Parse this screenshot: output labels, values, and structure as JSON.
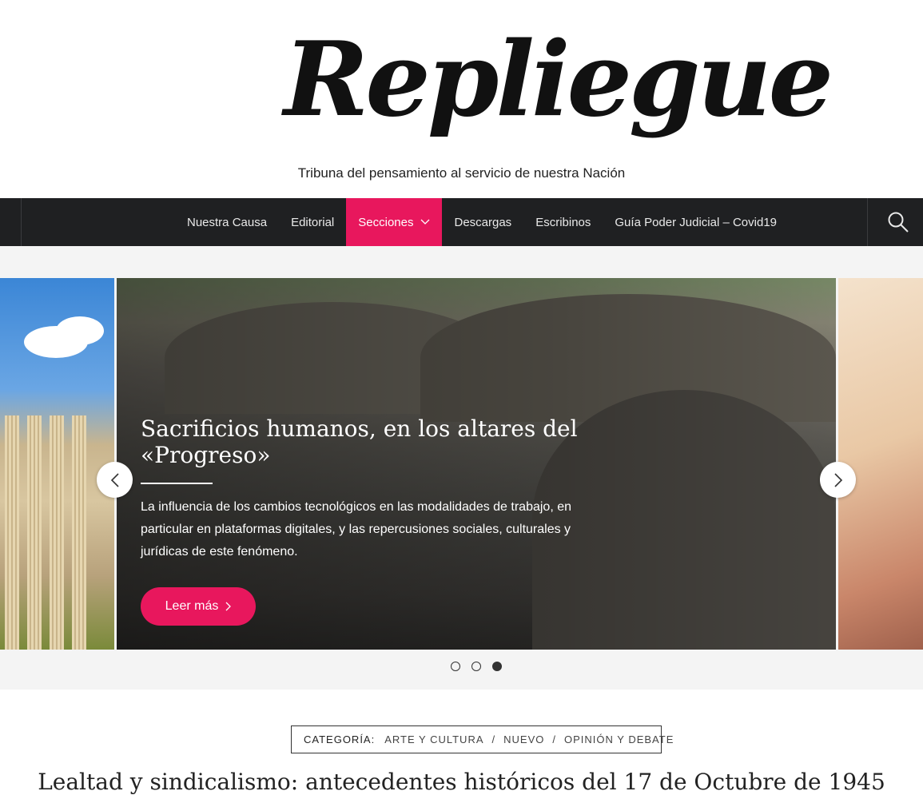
{
  "site": {
    "logo_text": "Repliegue",
    "tagline": "Tribuna del pensamiento al servicio de nuestra Nación"
  },
  "nav": {
    "items": [
      {
        "label": "Nuestra Causa"
      },
      {
        "label": "Editorial"
      },
      {
        "label": "Secciones",
        "active": true
      },
      {
        "label": "Descargas"
      },
      {
        "label": "Escribinos"
      },
      {
        "label": "Guía Poder Judicial – Covid19"
      }
    ],
    "search_icon": "search-icon"
  },
  "slider": {
    "title": "Sacrificios humanos, en los altares del «Progreso»",
    "excerpt": "La influencia de los cambios tecnológicos en las modalidades de trabajo, en particular en plataformas digitales, y las repercusiones sociales, culturales y jurídicas de este fenómeno.",
    "read_more": "Leer más",
    "dots": [
      {
        "active": false
      },
      {
        "active": false
      },
      {
        "active": true
      }
    ]
  },
  "post": {
    "category_label": "CATEGORÍA:",
    "categories": [
      "ARTE Y CULTURA",
      "NUEVO",
      "OPINIÓN Y DEBATE"
    ],
    "title": "Lealtad y sindicalismo: antecedentes históricos del 17 de Octubre de 1945"
  },
  "colors": {
    "accent": "#e8175d",
    "nav_bg": "#1f2022"
  }
}
